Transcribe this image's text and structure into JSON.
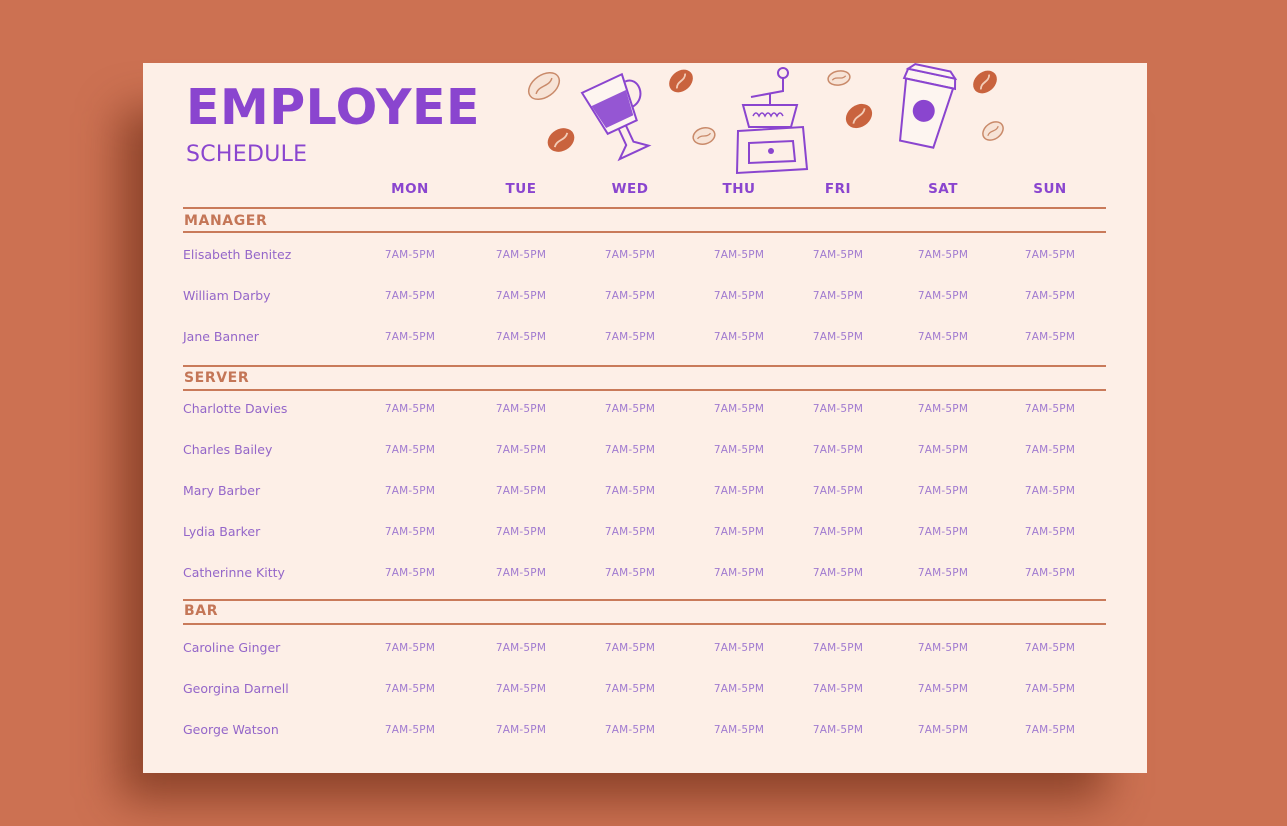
{
  "header": {
    "title": "EMPLOYEE",
    "subtitle": "SCHEDULE"
  },
  "colors": {
    "background": "#cc7152",
    "card": "#fdefe7",
    "accent_purple": "#8a45cf",
    "accent_brown": "#c47657"
  },
  "decorations": [
    "coffee-bean-icon",
    "irish-coffee-glass-icon",
    "coffee-grinder-icon",
    "takeaway-cup-icon"
  ],
  "days": [
    "MON",
    "TUE",
    "WED",
    "THU",
    "FRI",
    "SAT",
    "SUN"
  ],
  "sections": [
    {
      "label": "MANAGER",
      "employees": [
        {
          "name": "Elisabeth Benitez",
          "shifts": [
            "7AM-5PM",
            "7AM-5PM",
            "7AM-5PM",
            "7AM-5PM",
            "7AM-5PM",
            "7AM-5PM",
            "7AM-5PM"
          ]
        },
        {
          "name": "William Darby",
          "shifts": [
            "7AM-5PM",
            "7AM-5PM",
            "7AM-5PM",
            "7AM-5PM",
            "7AM-5PM",
            "7AM-5PM",
            "7AM-5PM"
          ]
        },
        {
          "name": "Jane Banner",
          "shifts": [
            "7AM-5PM",
            "7AM-5PM",
            "7AM-5PM",
            "7AM-5PM",
            "7AM-5PM",
            "7AM-5PM",
            "7AM-5PM"
          ]
        }
      ]
    },
    {
      "label": "SERVER",
      "employees": [
        {
          "name": "Charlotte Davies",
          "shifts": [
            "7AM-5PM",
            "7AM-5PM",
            "7AM-5PM",
            "7AM-5PM",
            "7AM-5PM",
            "7AM-5PM",
            "7AM-5PM"
          ]
        },
        {
          "name": "Charles Bailey",
          "shifts": [
            "7AM-5PM",
            "7AM-5PM",
            "7AM-5PM",
            "7AM-5PM",
            "7AM-5PM",
            "7AM-5PM",
            "7AM-5PM"
          ]
        },
        {
          "name": "Mary Barber",
          "shifts": [
            "7AM-5PM",
            "7AM-5PM",
            "7AM-5PM",
            "7AM-5PM",
            "7AM-5PM",
            "7AM-5PM",
            "7AM-5PM"
          ]
        },
        {
          "name": "Lydia Barker",
          "shifts": [
            "7AM-5PM",
            "7AM-5PM",
            "7AM-5PM",
            "7AM-5PM",
            "7AM-5PM",
            "7AM-5PM",
            "7AM-5PM"
          ]
        },
        {
          "name": "Catherinne Kitty",
          "shifts": [
            "7AM-5PM",
            "7AM-5PM",
            "7AM-5PM",
            "7AM-5PM",
            "7AM-5PM",
            "7AM-5PM",
            "7AM-5PM"
          ]
        }
      ]
    },
    {
      "label": "BAR",
      "employees": [
        {
          "name": "Caroline Ginger",
          "shifts": [
            "7AM-5PM",
            "7AM-5PM",
            "7AM-5PM",
            "7AM-5PM",
            "7AM-5PM",
            "7AM-5PM",
            "7AM-5PM"
          ]
        },
        {
          "name": "Georgina Darnell",
          "shifts": [
            "7AM-5PM",
            "7AM-5PM",
            "7AM-5PM",
            "7AM-5PM",
            "7AM-5PM",
            "7AM-5PM",
            "7AM-5PM"
          ]
        },
        {
          "name": "George Watson",
          "shifts": [
            "7AM-5PM",
            "7AM-5PM",
            "7AM-5PM",
            "7AM-5PM",
            "7AM-5PM",
            "7AM-5PM",
            "7AM-5PM"
          ]
        }
      ]
    }
  ]
}
